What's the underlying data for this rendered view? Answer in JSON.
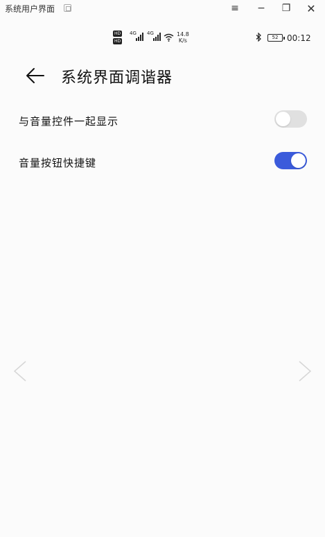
{
  "window": {
    "title": "系统用户界面",
    "menu_icon": "≡",
    "minimize_icon": "−",
    "restore_icon": "❐",
    "close_icon": "✕"
  },
  "status": {
    "net1": "4G",
    "net2": "4G",
    "hd1": "HD",
    "hd2": "HD",
    "speed_value": "14.8",
    "speed_unit": "K/s",
    "battery": "52",
    "time": "00:12"
  },
  "header": {
    "title": "系统界面调谐器"
  },
  "settings": [
    {
      "label": "与音量控件一起显示",
      "enabled": false
    },
    {
      "label": "音量按钮快捷键",
      "enabled": true
    }
  ],
  "colors": {
    "accent": "#3b5bdb",
    "toggle_off": "#e0e0e0",
    "background": "#fbfbfb"
  }
}
